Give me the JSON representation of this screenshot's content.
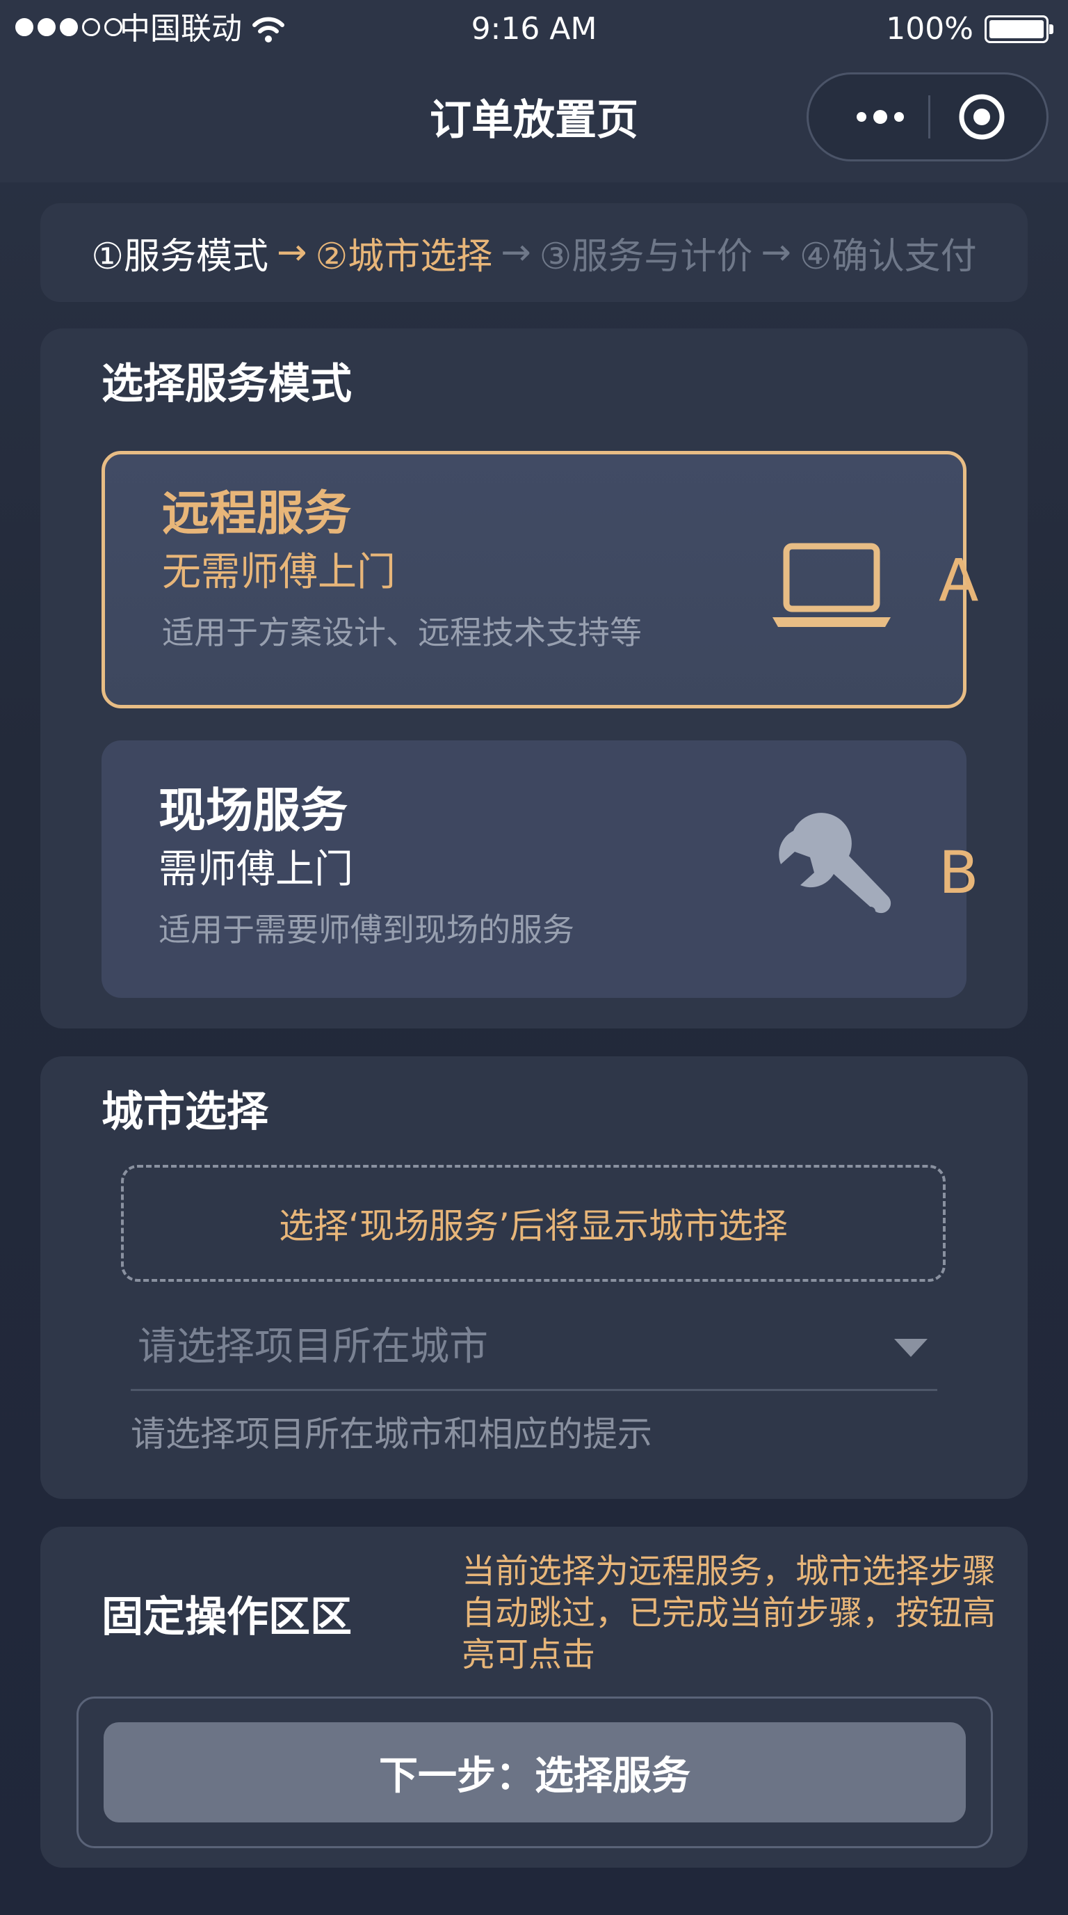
{
  "status_bar": {
    "carrier": "中国联动",
    "time": "9:16 AM",
    "battery": "100%",
    "signal_bars_filled": 3,
    "signal_bars_total": 5
  },
  "nav": {
    "title": "订单放置页"
  },
  "steps": {
    "items": [
      {
        "label": "①服务模式",
        "state": "done"
      },
      {
        "label": "②城市选择",
        "state": "current"
      },
      {
        "label": "③服务与计价",
        "state": "upcoming"
      },
      {
        "label": "④确认支付",
        "state": "upcoming"
      }
    ],
    "arrow": "→"
  },
  "service_mode": {
    "title": "选择服务模式",
    "options": [
      {
        "title": "远程服务",
        "subtitle": "无需师傅上门",
        "description": "适用于方案设计、远程技术支持等",
        "icon": "laptop-icon",
        "letter": "A",
        "selected": true
      },
      {
        "title": "现场服务",
        "subtitle": "需师傅上门",
        "description": "适用于需要师傅到现场的服务",
        "icon": "wrench-icon",
        "letter": "B",
        "selected": false
      }
    ]
  },
  "city": {
    "title": "城市选择",
    "hint": "选择‘现场服务’后将显示城市选择",
    "select_placeholder": "请选择项目所在城市",
    "helper": "请选择项目所在城市和相应的提示"
  },
  "action_area": {
    "title": "固定操作区区",
    "note": "当前选择为远程服务，城市选择步骤自动跳过，已完成当前步骤，按钮高亮可点击",
    "next_button": "下一步：选择服务"
  },
  "colors": {
    "accent": "#e8b679",
    "background": "#232a3a",
    "card": "#2f3749",
    "option": "#3e4760",
    "button": "#6c7486"
  }
}
